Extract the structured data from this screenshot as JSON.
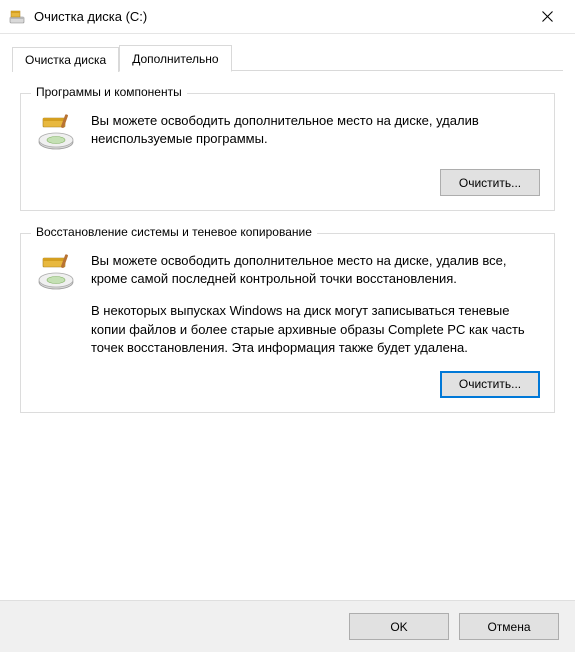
{
  "window": {
    "title": "Очистка диска  (C:)"
  },
  "tabs": {
    "cleanup": "Очистка диска",
    "more": "Дополнительно"
  },
  "group1": {
    "legend": "Программы и компоненты",
    "text": "Вы можете освободить дополнительное место на диске, удалив неиспользуемые программы.",
    "button": "Очистить..."
  },
  "group2": {
    "legend": "Восстановление системы и теневое копирование",
    "text1": "Вы можете освободить дополнительное место на диске, удалив все, кроме самой последней контрольной точки восстановления.",
    "text2": "В некоторых выпусках Windows на диск могут записываться теневые копии файлов и более старые архивные образы Complete PC как часть точек восстановления. Эта информация также будет удалена.",
    "button": "Очистить..."
  },
  "footer": {
    "ok": "OK",
    "cancel": "Отмена"
  },
  "icons": {
    "app": "disk-cleanup-icon",
    "close": "close-icon",
    "disk": "disk-broom-icon"
  }
}
